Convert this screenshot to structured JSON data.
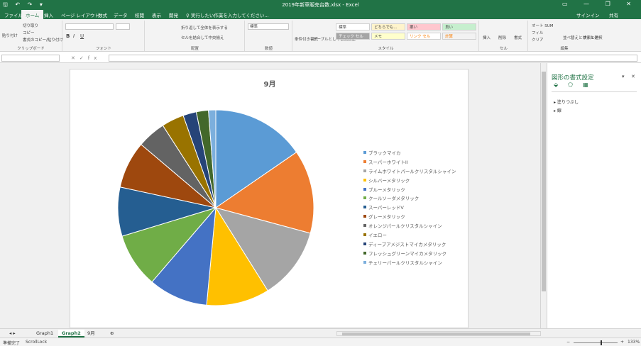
{
  "window": {
    "title": "2019年新車販売台数.xlsx - Excel",
    "qat": "🖫 ↶ ↷ ▾",
    "controls": "▭ — ❐ ✕",
    "signin": "サインイン",
    "share": "共有"
  },
  "tabs": [
    {
      "label": "ファイル"
    },
    {
      "label": "ホーム"
    },
    {
      "label": "挿入"
    },
    {
      "label": "ページ レイアウト"
    },
    {
      "label": "数式"
    },
    {
      "label": "データ"
    },
    {
      "label": "校閲"
    },
    {
      "label": "表示"
    },
    {
      "label": "開発"
    }
  ],
  "tell_me": "♀ 実行したい作業を入力してください...",
  "ribbon": {
    "clipboard": {
      "label": "クリップボード",
      "paste": "貼り付け",
      "cut": "切り取り",
      "copy": "コピー",
      "format_painter": "書式のコピー/貼り付け"
    },
    "font": {
      "label": "フォント",
      "name": "",
      "size": "",
      "bold": "B",
      "italic": "I",
      "underline": "U"
    },
    "alignment": {
      "label": "配置",
      "wrap": "折り返して全体を表示する",
      "merge": "セルを結合して中央揃え"
    },
    "number": {
      "label": "数値",
      "format": "標準"
    },
    "styles": {
      "label": "スタイル",
      "cond_format": "条件付き書式",
      "table_format": "テーブルとして書式設定",
      "cells": [
        {
          "label": "標準"
        },
        {
          "label": "どちらでも..."
        },
        {
          "label": "悪い"
        },
        {
          "label": "良い"
        },
        {
          "label": "チェック セル"
        },
        {
          "label": "メモ"
        },
        {
          "label": "リンク セル"
        },
        {
          "label": "計算"
        }
      ]
    },
    "cells": {
      "label": "セル",
      "insert": "挿入",
      "delete": "削除",
      "format": "書式"
    },
    "editing": {
      "label": "編集",
      "autosum": "オート SUM",
      "fill": "フィル",
      "clear": "クリア",
      "sort": "並べ替えとフィルター",
      "find": "検索と選択"
    }
  },
  "formula_bar": {
    "name_box": "",
    "fx": "fx",
    "cancel": "✕",
    "enter": "✓",
    "content": ""
  },
  "chart_data": {
    "type": "pie",
    "title": "9月",
    "categories": [
      "ブラックマイカ",
      "スーパーホワイトII",
      "ライムホワイトパールクリスタルシャイン",
      "シルバーメタリック",
      "ブルーメタリック",
      "クールソーダメタリック",
      "スーパーレッドV",
      "グレーメタリック",
      "オレンジパールクリスタルシャイン",
      "イエロー",
      "ディープアメジストマイカメタリック",
      "フレッシュグリーンマイカメタリック",
      "チェリーパールクリスタルシャイン"
    ],
    "values": [
      15.4,
      13.8,
      11.9,
      10.4,
      9.8,
      9.0,
      8.1,
      7.8,
      4.7,
      3.7,
      2.2,
      2.0,
      1.2
    ],
    "colors": [
      "#5b9bd5",
      "#ed7d31",
      "#a5a5a5",
      "#ffc000",
      "#4472c4",
      "#70ad47",
      "#255e91",
      "#9e480e",
      "#636363",
      "#997300",
      "#264478",
      "#43682b",
      "#7cafdd"
    ],
    "legend_position": "right"
  },
  "format_pane": {
    "title": "図形の書式設定",
    "collapse": "▾",
    "close": "✕",
    "icons": [
      "fill-line-icon",
      "effects-icon",
      "size-properties-icon"
    ],
    "icon_glyphs": "⬙⬠▦",
    "sections": [
      {
        "label": "塗りつぶし"
      },
      {
        "label": "線"
      }
    ]
  },
  "sheets": {
    "nav": "◂ ▸",
    "tabs": [
      {
        "label": "Graph1"
      },
      {
        "label": "Graph2"
      },
      {
        "label": "9月"
      }
    ],
    "active": "Graph2",
    "add": "⊕"
  },
  "status": {
    "ready": "準備完了",
    "scroll_lock": "ScrollLock",
    "zoom": "133%",
    "zoom_minus": "−",
    "zoom_plus": "+"
  }
}
